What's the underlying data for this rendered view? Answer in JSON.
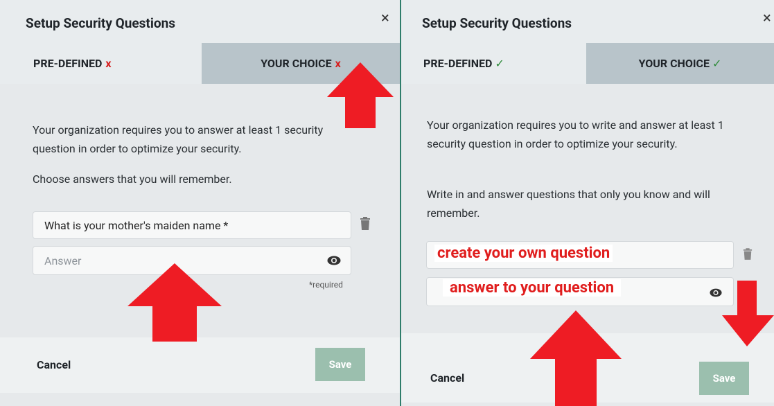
{
  "left_panel": {
    "title": "Setup Security Questions",
    "close": "×",
    "tab_predefined": "PRE-DEFINED",
    "tab_predefined_mark": "x",
    "tab_yourchoice": "YOUR CHOICE",
    "tab_yourchoice_mark": "x",
    "desc": "Your organization requires you to answer at least 1 security question in order to optimize your security.",
    "hint": "Choose answers that you will remember.",
    "question_value": "What is your mother's maiden name *",
    "answer_placeholder": "Answer",
    "required_note": "*required",
    "cancel": "Cancel",
    "save": "Save"
  },
  "right_panel": {
    "title": "Setup Security Questions",
    "close": "×",
    "tab_predefined": "PRE-DEFINED",
    "tab_predefined_mark": "✓",
    "tab_yourchoice": "YOUR CHOICE",
    "tab_yourchoice_mark": "✓",
    "desc": "Your organization requires you to write and answer at least 1 security question in order to optimize your security.",
    "hint": "Write in and answer questions that only you know and will remember.",
    "question_annotation": "create your own question",
    "answer_annotation": "answer to your question",
    "cancel": "Cancel",
    "save": "Save"
  },
  "icons": {
    "close": "close-icon",
    "trash": "trash-icon",
    "eye": "eye-icon",
    "arrow": "red-arrow-icon"
  },
  "colors": {
    "accent_red": "#e01d1d",
    "save_button": "#9bbfae",
    "tab_inactive": "#b8c4ca",
    "divider": "#2f7d6b"
  }
}
